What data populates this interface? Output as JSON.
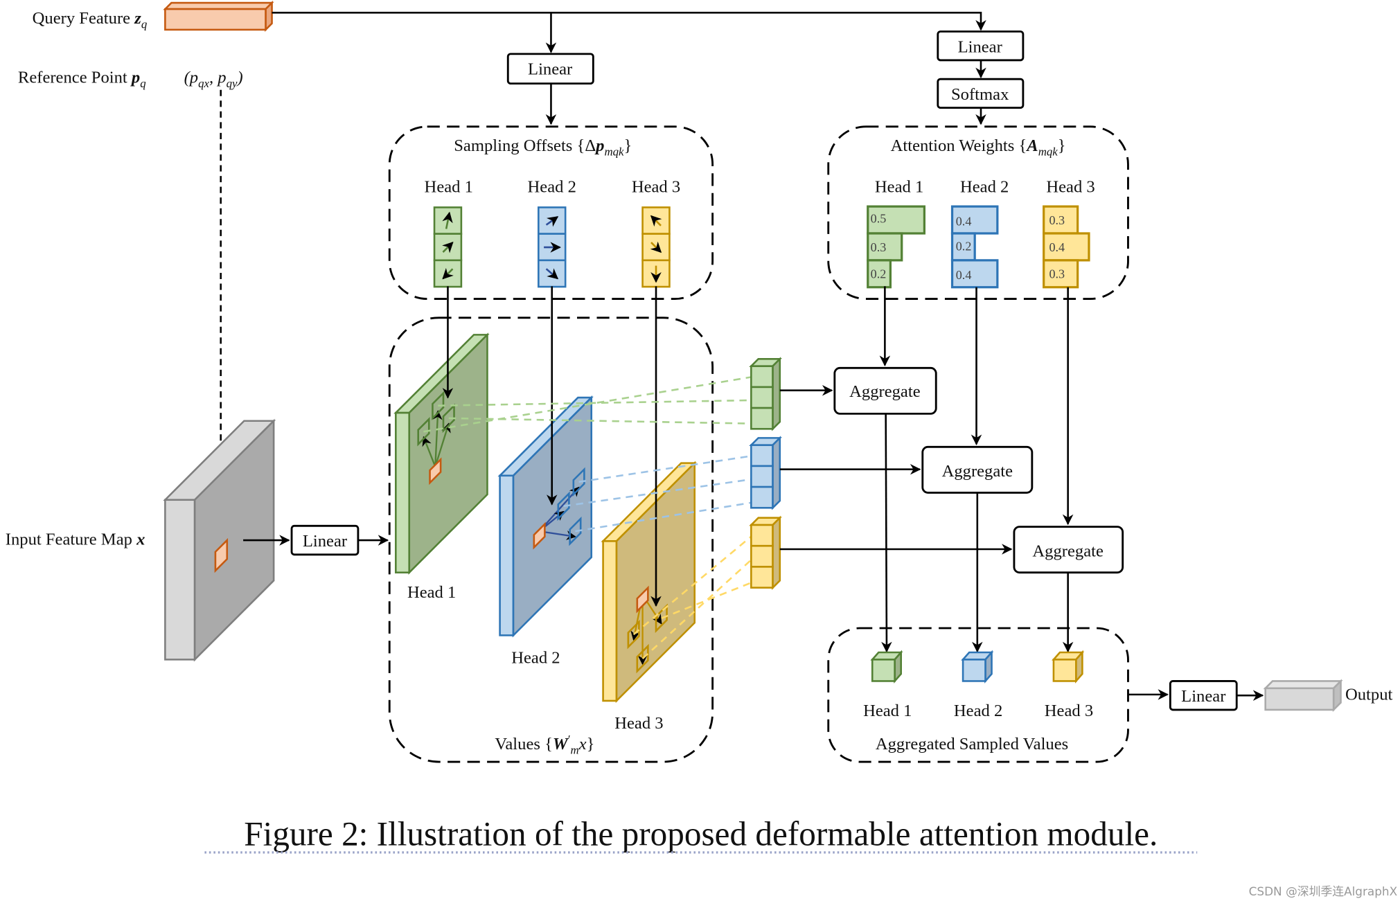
{
  "inputs": {
    "query_label": "Query Feature",
    "query_symbol": "z",
    "query_sub": "q",
    "reference_label": "Reference Point",
    "reference_symbol": "p",
    "reference_sub": "q",
    "reference_coords": "(p",
    "reference_coords_x": "qx",
    "reference_coords_sep": ", p",
    "reference_coords_y": "qy",
    "reference_coords_end": ")",
    "input_map_label": "Input Feature Map",
    "input_map_symbol": "x"
  },
  "linear_label": "Linear",
  "softmax_label": "Softmax",
  "aggregate_label": "Aggregate",
  "output_label": "Output",
  "heads": [
    "Head 1",
    "Head 2",
    "Head 3"
  ],
  "sampling_offsets": {
    "title": "Sampling Offsets {Δ",
    "symbol": "p",
    "sub": "mqk",
    "close": "}"
  },
  "attention_weights": {
    "title": "Attention Weights {",
    "symbol": "A",
    "sub": "mqk",
    "close": "}",
    "values": [
      [
        "0.5",
        "0.3",
        "0.2"
      ],
      [
        "0.4",
        "0.2",
        "0.4"
      ],
      [
        "0.3",
        "0.4",
        "0.3"
      ]
    ],
    "numeric": [
      [
        0.5,
        0.3,
        0.2
      ],
      [
        0.4,
        0.2,
        0.4
      ],
      [
        0.3,
        0.4,
        0.3
      ]
    ]
  },
  "values": {
    "title": "Values {",
    "symbol": "W",
    "prime": "′",
    "sub": "m",
    "var": "x",
    "close": "}"
  },
  "aggregated_label": "Aggregated Sampled Values",
  "caption": "Figure 2: Illustration of the proposed deformable attention module.",
  "watermark": "CSDN @深圳季连AlgraphX",
  "colors": {
    "green_fill": "#c5e0b4",
    "green_stroke": "#538135",
    "green_plane": "#9db38a",
    "blue_fill": "#bdd7ee",
    "blue_stroke": "#2e75b6",
    "blue_plane": "#99aec3",
    "yellow_fill": "#ffe699",
    "yellow_stroke": "#bf9000",
    "yellow_plane": "#cfba7c",
    "orange_fill": "#f8cbad",
    "orange_stroke": "#c55a11",
    "gray_fill": "#d9d9d9",
    "gray_stroke": "#7f7f7f",
    "gray_plane": "#aaaaaa"
  }
}
